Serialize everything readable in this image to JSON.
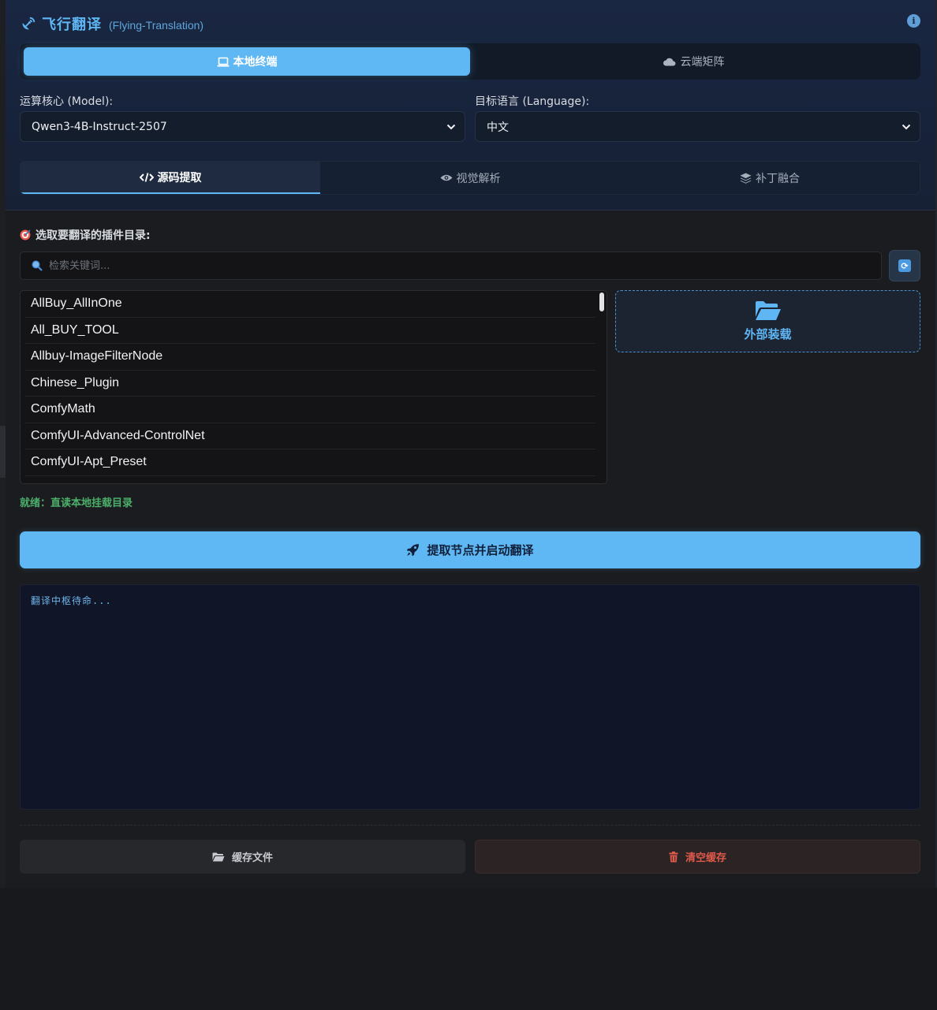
{
  "header": {
    "title": "飞行翻译",
    "subtitle": "(Flying-Translation)"
  },
  "mode_tabs": [
    {
      "label": "本地终端",
      "active": true
    },
    {
      "label": "云端矩阵",
      "active": false
    }
  ],
  "model": {
    "label": "运算核心 (Model):",
    "value": "Qwen3-4B-Instruct-2507"
  },
  "language": {
    "label": "目标语言 (Language):",
    "value": "中文"
  },
  "sub_tabs": [
    {
      "label": "源码提取",
      "active": true
    },
    {
      "label": "视觉解析",
      "active": false
    },
    {
      "label": "补丁融合",
      "active": false
    }
  ],
  "plugins": {
    "label": "选取要翻译的插件目录:",
    "search_placeholder": "检索关键词...",
    "items": [
      "AllBuy_AllInOne",
      "All_BUY_TOOL",
      "Allbuy-ImageFilterNode",
      "Chinese_Plugin",
      "ComfyMath",
      "ComfyUI-Advanced-ControlNet",
      "ComfyUI-Apt_Preset"
    ]
  },
  "external_load": {
    "label": "外部装载"
  },
  "status": "就绪：直读本地挂载目录",
  "primary_button": "提取节点并启动翻译",
  "log_text": "翻译中枢待命...",
  "actions": {
    "cache_label": "缓存文件",
    "clear_label": "清空缓存"
  },
  "colors": {
    "accent": "#5fb8f3",
    "status_green": "#4caf6a",
    "danger": "#e05a4b"
  }
}
